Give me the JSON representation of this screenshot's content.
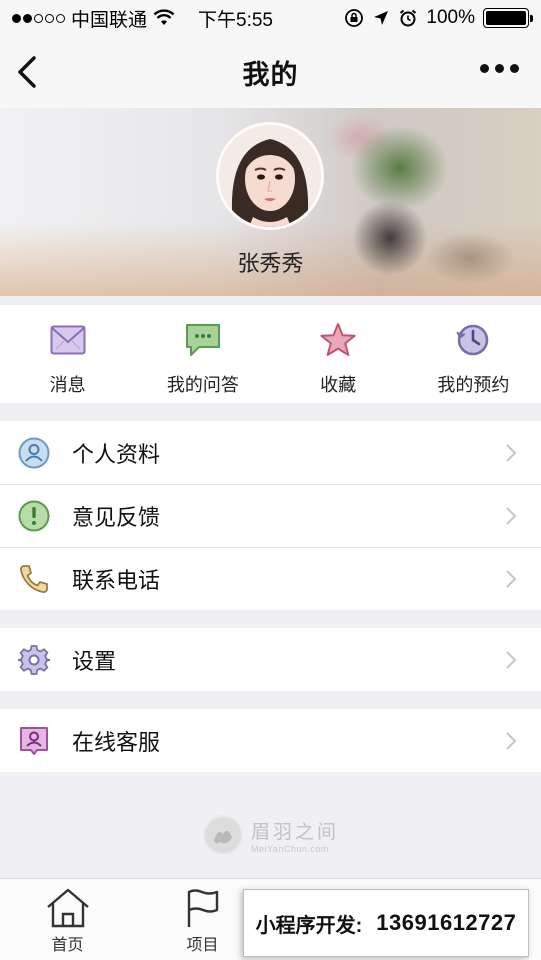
{
  "status_bar": {
    "carrier": "中国联通",
    "time": "下午5:55",
    "battery": "100%",
    "battery_level": 1.0
  },
  "nav": {
    "title": "我的",
    "back_icon": "chevron-left-icon",
    "more_icon": "more-dots-icon"
  },
  "profile": {
    "name": "张秀秀"
  },
  "quick_actions": [
    {
      "label": "消息",
      "icon": "envelope-icon",
      "color": "#8e6bb5"
    },
    {
      "label": "我的问答",
      "icon": "chat-bubble-icon",
      "color": "#5c9a52"
    },
    {
      "label": "收藏",
      "icon": "star-icon",
      "color": "#c0546f"
    },
    {
      "label": "我的预约",
      "icon": "history-clock-icon",
      "color": "#7a6fa8"
    }
  ],
  "menu": {
    "group1": [
      {
        "label": "个人资料",
        "icon": "user-profile-icon"
      },
      {
        "label": "意见反馈",
        "icon": "feedback-icon"
      },
      {
        "label": "联系电话",
        "icon": "phone-icon"
      }
    ],
    "group2": [
      {
        "label": "设置",
        "icon": "gear-icon"
      }
    ],
    "group3": [
      {
        "label": "在线客服",
        "icon": "customer-service-icon"
      }
    ]
  },
  "brand": {
    "name": "眉羽之间",
    "sub": "MeiYanChun.com"
  },
  "tabs": [
    {
      "label": "首页",
      "icon": "home-icon"
    },
    {
      "label": "项目",
      "icon": "flag-icon"
    }
  ],
  "promo": {
    "label": "小程序开发:",
    "phone": "13691612727"
  }
}
